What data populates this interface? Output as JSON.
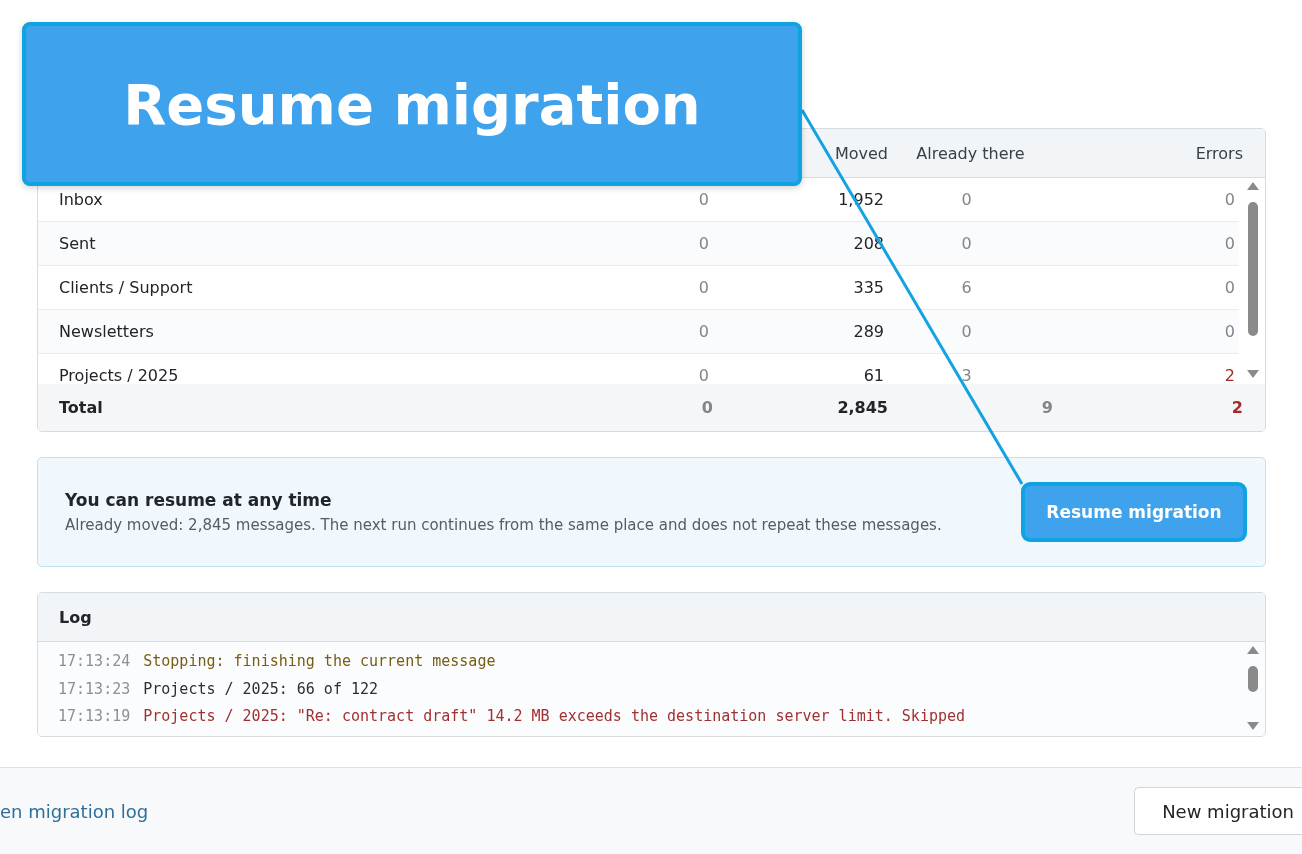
{
  "callout": {
    "text": "Resume migration"
  },
  "table": {
    "header": {
      "moved": "Moved",
      "already_there": "Already there",
      "errors": "Errors"
    },
    "rows": [
      {
        "name": "Inbox",
        "column_2": "0",
        "moved": "1,952",
        "already_there": "0",
        "errors": "0",
        "has_errors": false
      },
      {
        "name": "Sent",
        "column_2": "0",
        "moved": "208",
        "already_there": "0",
        "errors": "0",
        "has_errors": false
      },
      {
        "name": "Clients / Support",
        "column_2": "0",
        "moved": "335",
        "already_there": "6",
        "errors": "0",
        "has_errors": false
      },
      {
        "name": "Newsletters",
        "column_2": "0",
        "moved": "289",
        "already_there": "0",
        "errors": "0",
        "has_errors": false
      },
      {
        "name": "Projects / 2025",
        "column_2": "0",
        "moved": "61",
        "already_there": "3",
        "errors": "2",
        "has_errors": true
      }
    ],
    "total": {
      "label": "Total",
      "column_2": "0",
      "moved": "2,845",
      "already_there": "9",
      "errors": "2",
      "has_errors": true
    }
  },
  "notice": {
    "title": "You can resume at any time",
    "text": "Already moved: 2,845 messages. The next run continues from the same place and does not repeat these messages.",
    "button": {
      "label": "Resume migration",
      "highlighted": true
    }
  },
  "log": {
    "title": "Log",
    "entries": [
      {
        "time": "17:13:24",
        "text": "Stopping: finishing the current message",
        "kind": "warning"
      },
      {
        "time": "17:13:23",
        "text": "Projects / 2025: 66 of 122",
        "kind": "info"
      },
      {
        "time": "17:13:19",
        "text": "Projects / 2025: \"Re: contract draft\" 14.2 MB exceeds the destination server limit. Skipped",
        "kind": "error"
      }
    ]
  },
  "footer": {
    "link": "en migration log",
    "button": "New migration"
  }
}
